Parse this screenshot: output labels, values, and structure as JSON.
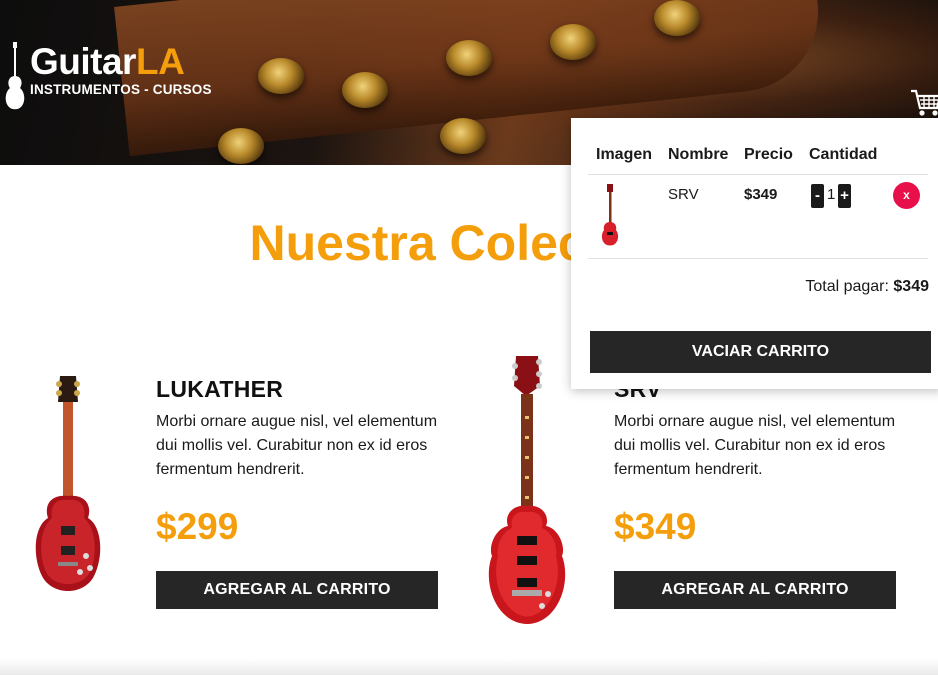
{
  "header": {
    "logo": {
      "main": "Guitar",
      "accent": "LA",
      "subtitle": "INSTRUMENTOS - CURSOS"
    },
    "cart_icon": "cart-icon"
  },
  "main": {
    "title": "Nuestra Colección"
  },
  "products": [
    {
      "name": "LUKATHER",
      "description": "Morbi ornare augue nisl, vel elementum dui mollis vel. Curabitur non ex id eros fermentum hendrerit.",
      "price": "$299",
      "button": "AGREGAR AL CARRITO"
    },
    {
      "name": "SRV",
      "description": "Morbi ornare augue nisl, vel elementum dui mollis vel. Curabitur non ex id eros fermentum hendrerit.",
      "price": "$349",
      "button": "AGREGAR AL CARRITO"
    }
  ],
  "cart": {
    "headers": [
      "Imagen",
      "Nombre",
      "Precio",
      "Cantidad"
    ],
    "items": [
      {
        "name": "SRV",
        "price": "$349",
        "quantity": "1",
        "decrement": "-",
        "increment": "+",
        "remove": "x"
      }
    ],
    "total_label": "Total pagar:",
    "total_value": "$349",
    "empty_button": "VACIAR CARRITO"
  },
  "colors": {
    "accent": "#f59e0b",
    "dark": "#262626",
    "remove": "#e8104a"
  }
}
